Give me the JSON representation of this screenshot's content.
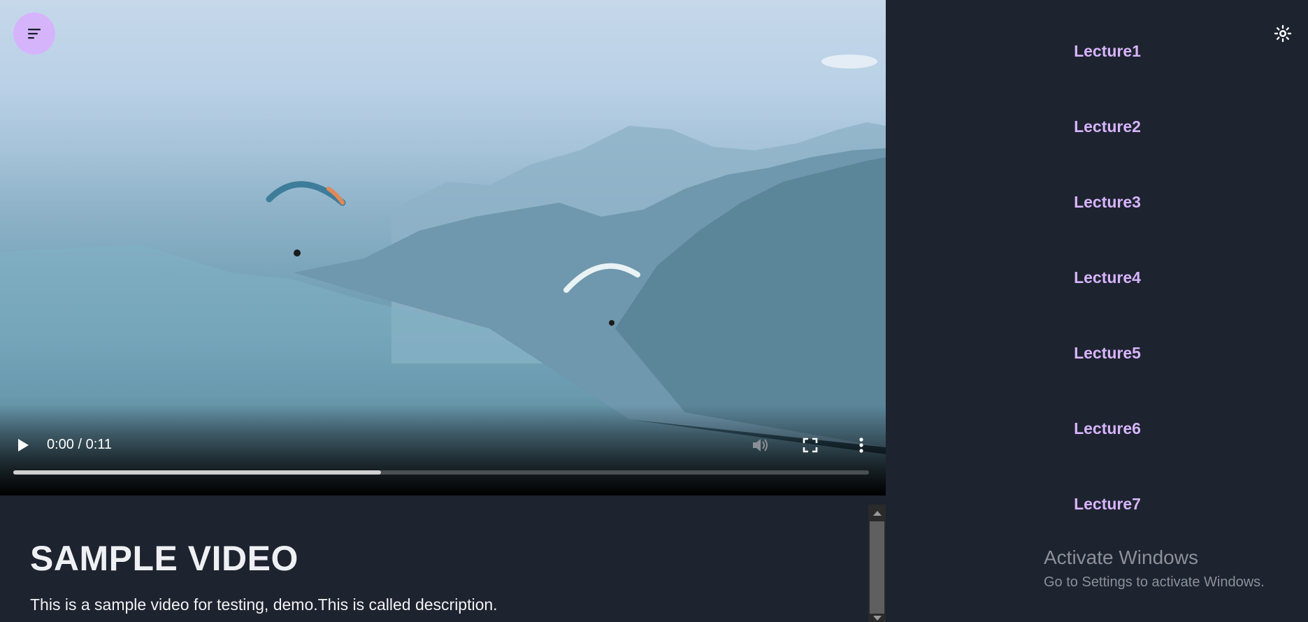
{
  "video": {
    "current_time": "0:00",
    "duration": "0:11",
    "time_display": "0:00 / 0:11",
    "progress_buffered_fraction": 0.43
  },
  "content": {
    "title": "SAMPLE VIDEO",
    "description": "This is a sample video for testing, demo.This is called description."
  },
  "sidebar": {
    "lectures": [
      {
        "label": "Lecture1"
      },
      {
        "label": "Lecture2"
      },
      {
        "label": "Lecture3"
      },
      {
        "label": "Lecture4"
      },
      {
        "label": "Lecture5"
      },
      {
        "label": "Lecture6"
      },
      {
        "label": "Lecture7"
      }
    ]
  },
  "watermark": {
    "line1": "Activate Windows",
    "line2": "Go to Settings to activate Windows."
  },
  "colors": {
    "accent": "#d6b4fc",
    "background": "#1d232f"
  },
  "icons": {
    "menu": "menu-icon",
    "play": "play-icon",
    "volume": "volume-icon",
    "fullscreen": "fullscreen-icon",
    "more": "more-vertical-icon",
    "theme": "sun-icon"
  }
}
